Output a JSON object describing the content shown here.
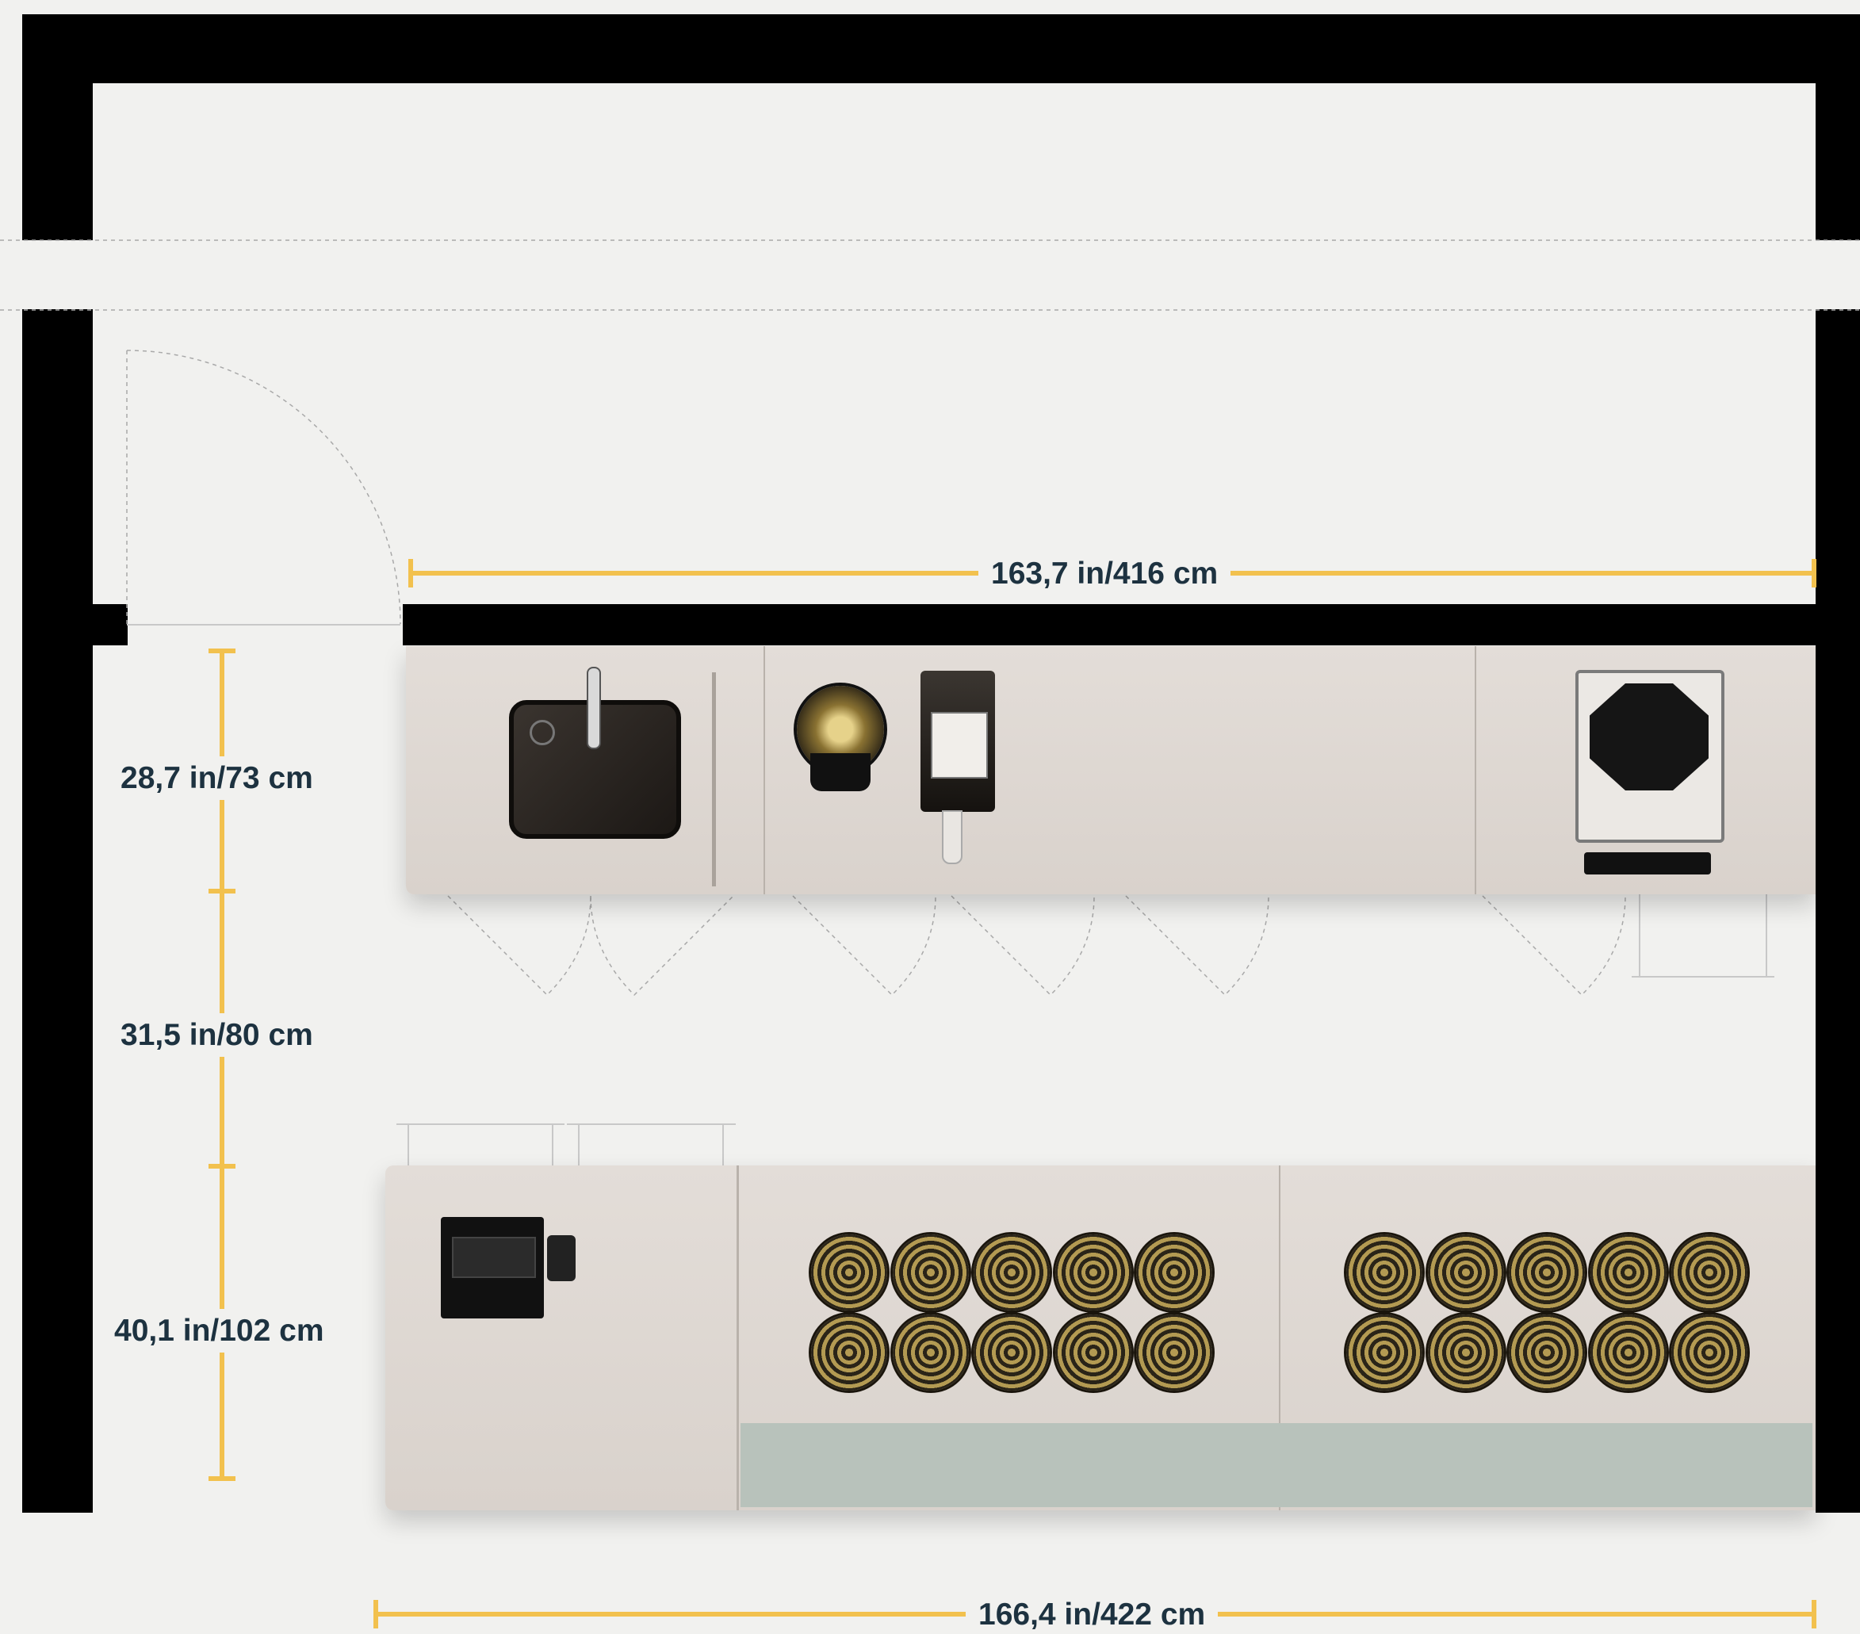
{
  "colors": {
    "background": "#f1f1ef",
    "wall": "#000000",
    "dimension_line": "#f2c14e",
    "label_text": "#1d3240",
    "counter": "#ddd6d0"
  },
  "dimensions": {
    "top_width": "163,7 in/416 cm",
    "bottom_width": "166,4 in/422 cm",
    "counter_depth_top": "28,7 in/73 cm",
    "aisle": "31,5 in/80 cm",
    "counter_depth_bottom": "40,1 in/102 cm"
  },
  "icons": {
    "sink": "sink-icon",
    "coffee_grinder": "grinder-icon",
    "water_dispenser": "dispenser-icon",
    "espresso_machine": "espresso-machine-icon",
    "cash_register": "register-icon",
    "burners": "induction-burner-icon"
  }
}
